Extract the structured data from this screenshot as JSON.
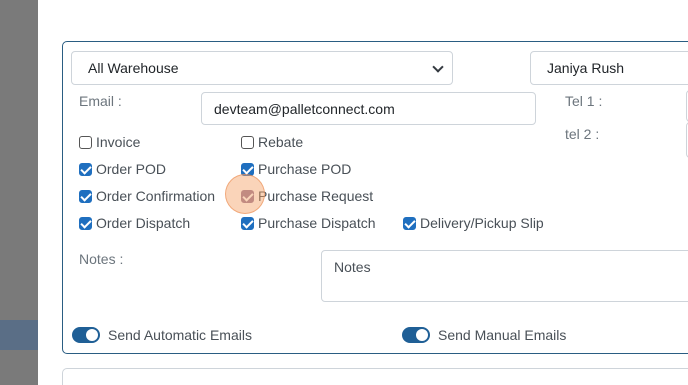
{
  "warehouse_select": {
    "value": "All Warehouse"
  },
  "contact_select": {
    "value": "Janiya Rush"
  },
  "email": {
    "label": "Email :",
    "value": "devteam@palletconnect.com"
  },
  "tel1": {
    "label": "Tel 1 :"
  },
  "tel2": {
    "label": "tel 2 :"
  },
  "checkboxes": [
    {
      "label": "Invoice",
      "checked": false
    },
    {
      "label": "Rebate",
      "checked": false
    },
    {
      "label": "Order POD",
      "checked": true
    },
    {
      "label": "Purchase POD",
      "checked": true
    },
    {
      "label": "Order Confirmation",
      "checked": true
    },
    {
      "label": "Purchase Request",
      "checked": true
    },
    {
      "label": "Order Dispatch",
      "checked": true
    },
    {
      "label": "Purchase Dispatch",
      "checked": true
    },
    {
      "label": "Delivery/Pickup Slip",
      "checked": true
    }
  ],
  "notes": {
    "label": "Notes :",
    "placeholder": "Notes"
  },
  "toggles": {
    "automatic": {
      "label": "Send Automatic Emails",
      "on": true
    },
    "manual": {
      "label": "Send Manual Emails",
      "on": true
    }
  },
  "colors": {
    "accent": "#1f6fbf",
    "card_border": "#2a5d82",
    "toggle": "#1f5f96"
  }
}
